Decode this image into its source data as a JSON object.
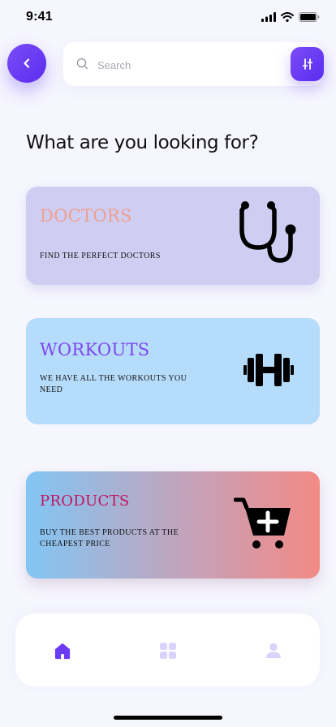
{
  "status_bar": {
    "time": "9:41"
  },
  "search": {
    "placeholder": "Search",
    "value": ""
  },
  "page": {
    "title": "What are you looking for?"
  },
  "cards": [
    {
      "title": "DOCTORS",
      "description": "FIND THE PERFECT DOCTORS",
      "icon": "stethoscope-icon",
      "color": "#cfcdf2",
      "title_color": "#f0a08f"
    },
    {
      "title": "WORKOUTS",
      "description": "WE HAVE ALL THE WORKOUTS YOU NEED",
      "icon": "dumbbell-icon",
      "color": "#b6dcfb",
      "title_color": "#7d46ee"
    },
    {
      "title": "PRODUCTS",
      "description": "BUY THE BEST PRODUCTS AT THE CHEAPEST PRICE",
      "icon": "cart-plus-icon",
      "color": "gradient #82c6f4 to #f38a85",
      "title_color": "#c3145f"
    }
  ],
  "bottom_nav": {
    "items": [
      {
        "icon": "home-icon",
        "active": true
      },
      {
        "icon": "grid-icon",
        "active": false
      },
      {
        "icon": "user-icon",
        "active": false
      }
    ]
  },
  "colors": {
    "accent": "#6a3cf4",
    "background": "#f6f6fe",
    "inactive_nav": "#d9d4fb"
  }
}
